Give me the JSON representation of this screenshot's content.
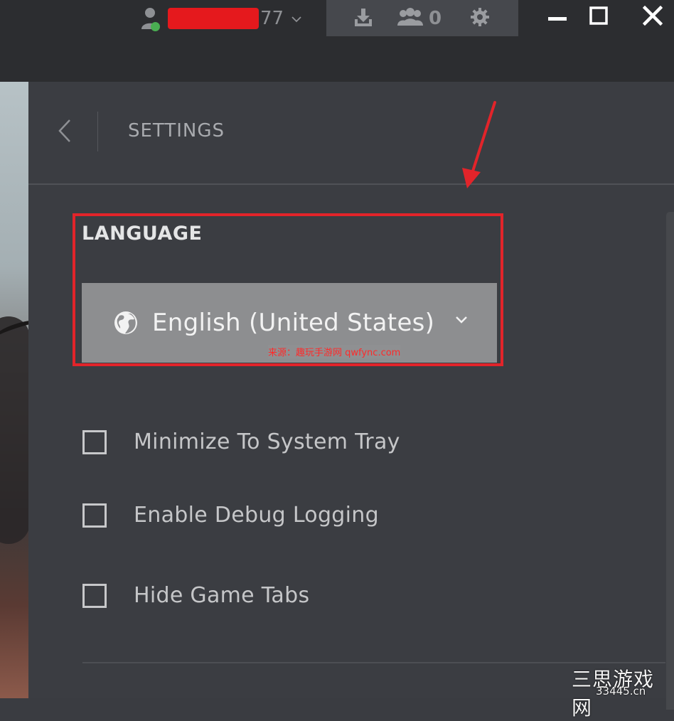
{
  "topbar": {
    "username_suffix": "77",
    "friends_count": "0",
    "icons": {
      "user": "user-avatar-icon",
      "download": "download-icon",
      "friends": "friends-icon",
      "settings": "gear-icon",
      "minimize": "minimize-icon",
      "maximize": "maximize-icon",
      "close": "close-icon"
    },
    "status_color": "#4aad52",
    "redaction_color": "#e5191d"
  },
  "settings": {
    "title": "SETTINGS",
    "language": {
      "label": "LANGUAGE",
      "selected": "English (United States)",
      "icon": "globe-icon"
    },
    "options": [
      {
        "label": "Minimize To System Tray",
        "checked": false
      },
      {
        "label": "Enable Debug Logging",
        "checked": false
      },
      {
        "label": "Hide Game Tabs",
        "checked": false
      }
    ]
  },
  "annotation": {
    "highlight_color": "#e2242a",
    "source_text": "来源：趣玩手游网 qwfync.com"
  },
  "watermark": {
    "name": "三思游戏网",
    "url": "33445.cn"
  }
}
